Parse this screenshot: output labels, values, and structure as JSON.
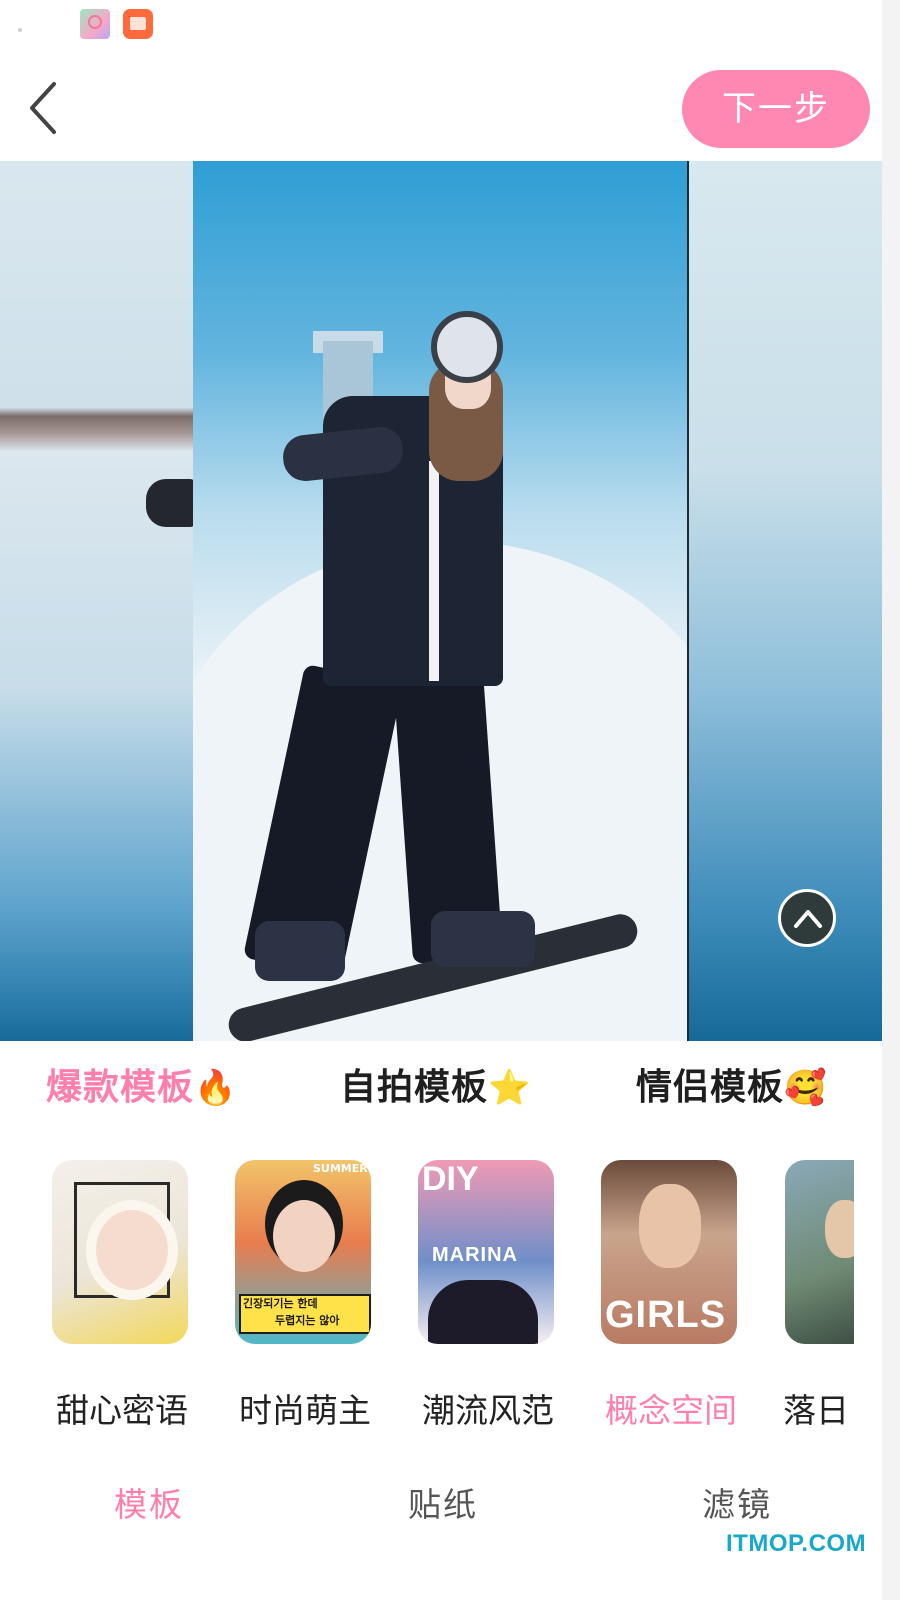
{
  "status_bar": {
    "icons": [
      "app-notification-icon",
      "book-app-icon"
    ]
  },
  "top_nav": {
    "back_icon": "chevron-left-icon",
    "next_label": "下一步",
    "accent_color": "#ff88b3"
  },
  "carousel": {
    "scroll_up_icon": "chevron-up-icon"
  },
  "categories": [
    {
      "label": "爆款模板",
      "emoji": "🔥",
      "active": true
    },
    {
      "label": "自拍模板",
      "emoji": "⭐",
      "active": false
    },
    {
      "label": "情侣模板",
      "emoji": "🥰",
      "active": false
    }
  ],
  "templates": [
    {
      "label": "甜心密语",
      "selected": false
    },
    {
      "label": "时尚萌主",
      "selected": false,
      "thumb_text": [
        "SUMMER",
        "긴장되기는 한데",
        "두렵지는 않아"
      ]
    },
    {
      "label": "潮流风范",
      "selected": false,
      "thumb_text": [
        "DIY",
        "MARINA"
      ]
    },
    {
      "label": "概念空间",
      "selected": true,
      "thumb_text": [
        "GIRLS"
      ]
    },
    {
      "label": "落日",
      "selected": false
    }
  ],
  "bottom_tabs": [
    {
      "label": "模板",
      "active": true
    },
    {
      "label": "贴纸",
      "active": false
    },
    {
      "label": "滤镜",
      "active": false
    }
  ],
  "watermark": "ITMOP.COM",
  "colors": {
    "accent": "#ff7fab",
    "button": "#ff88b3"
  }
}
